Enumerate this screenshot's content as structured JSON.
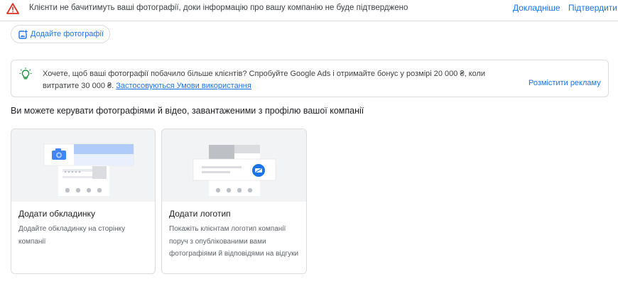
{
  "banner": {
    "icon": "warning-triangle-icon",
    "message": "Клієнти не бачитимуть ваші фотографії, доки інформацію про вашу компанію не буде підтверджено",
    "learn_more": "Докладніше",
    "verify": "Підтвердити"
  },
  "add_photos": {
    "icon": "add-photo-icon",
    "label": "Додайте фотографії"
  },
  "promo": {
    "icon": "lightbulb-icon",
    "text": "Хочете, щоб ваші фотографії побачило більше клієнтів? Спробуйте Google Ads і отримайте бонус у розмірі 20 000 ₴, коли витратите 30 000 ₴.",
    "terms_link": "Застосовуються Умови використання",
    "cta": "Розмістити рекламу"
  },
  "section": {
    "title": "Ви можете керувати фотографіями й відео, завантаженими з профілю вашої компанії"
  },
  "cards": [
    {
      "title": "Додати обкладинку",
      "description": "Додайте обкладинку на сторінку компанії",
      "illustration_icon": "camera-icon"
    },
    {
      "title": "Додати логотип",
      "description": "Покажіть клієнтам логотип компанії поруч з опублікованими вами фотографіями й відповідями на відгуки",
      "illustration_icon": "logo-badge-icon"
    }
  ],
  "colors": {
    "link": "#1a73e8",
    "warning": "#d93025",
    "bulb": "#1e8e3e",
    "border": "#dadce0"
  }
}
